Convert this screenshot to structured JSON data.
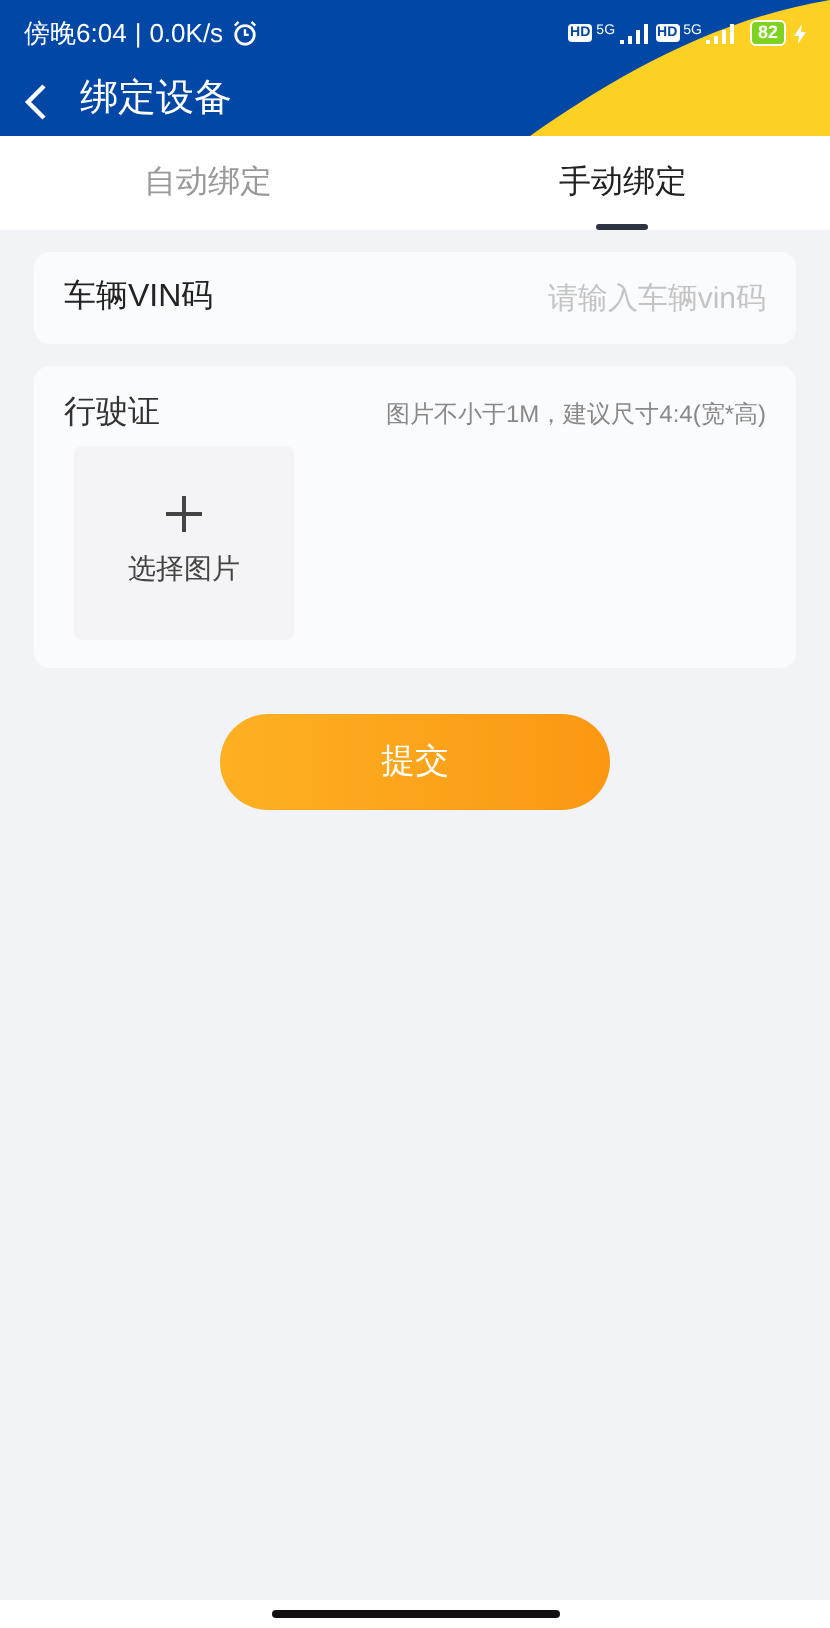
{
  "status_bar": {
    "time": "傍晚6:04",
    "separator": "|",
    "speed": "0.0K/s",
    "network": [
      "5G",
      "5G"
    ],
    "hd": [
      "HD",
      "HD"
    ],
    "battery": "82"
  },
  "header": {
    "title": "绑定设备"
  },
  "tabs": [
    {
      "label": "自动绑定",
      "selected": false
    },
    {
      "label": "手动绑定",
      "selected": true
    }
  ],
  "vin": {
    "label": "车辆VIN码",
    "placeholder": "请输入车辆vin码"
  },
  "license": {
    "label": "行驶证",
    "hint": "图片不小于1M，建议尺寸4:4(宽*高)",
    "upload_label": "选择图片"
  },
  "submit": "提交"
}
